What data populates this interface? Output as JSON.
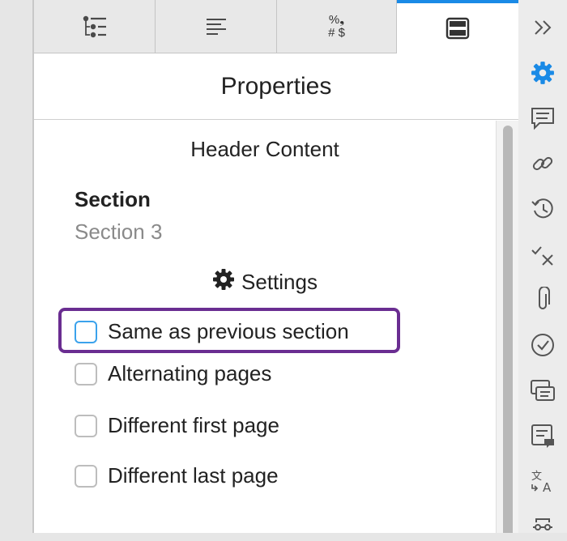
{
  "tabs": [
    {
      "icon": "list-tree-icon",
      "active": false
    },
    {
      "icon": "paragraph-align-icon",
      "active": false
    },
    {
      "icon": "number-format-icon",
      "active": false,
      "glyph_top": "%❟",
      "glyph_bottom": "# $"
    },
    {
      "icon": "header-layout-icon",
      "active": true
    }
  ],
  "panel": {
    "title": "Properties",
    "heading": "Header Content",
    "section_label": "Section",
    "section_value": "Section 3",
    "settings_label": "Settings",
    "options": [
      {
        "label": "Same as previous section",
        "checked": false,
        "focused": true
      },
      {
        "label": "Alternating pages",
        "checked": false
      },
      {
        "label": "Different first page",
        "checked": false
      },
      {
        "label": "Different last page",
        "checked": false
      }
    ]
  },
  "right_toolbar": {
    "icons": [
      "collapse-chevrons-icon",
      "settings-gear-icon",
      "comment-icon",
      "link-icon",
      "history-icon",
      "track-changes-icon",
      "attachment-icon",
      "checkmark-circle-icon",
      "cross-reference-icon",
      "note-icon",
      "translate-icon",
      "more-icon"
    ]
  },
  "colors": {
    "accent": "#1a8ae6",
    "highlight": "#6a2d91",
    "muted_text": "#8a8a8a"
  }
}
